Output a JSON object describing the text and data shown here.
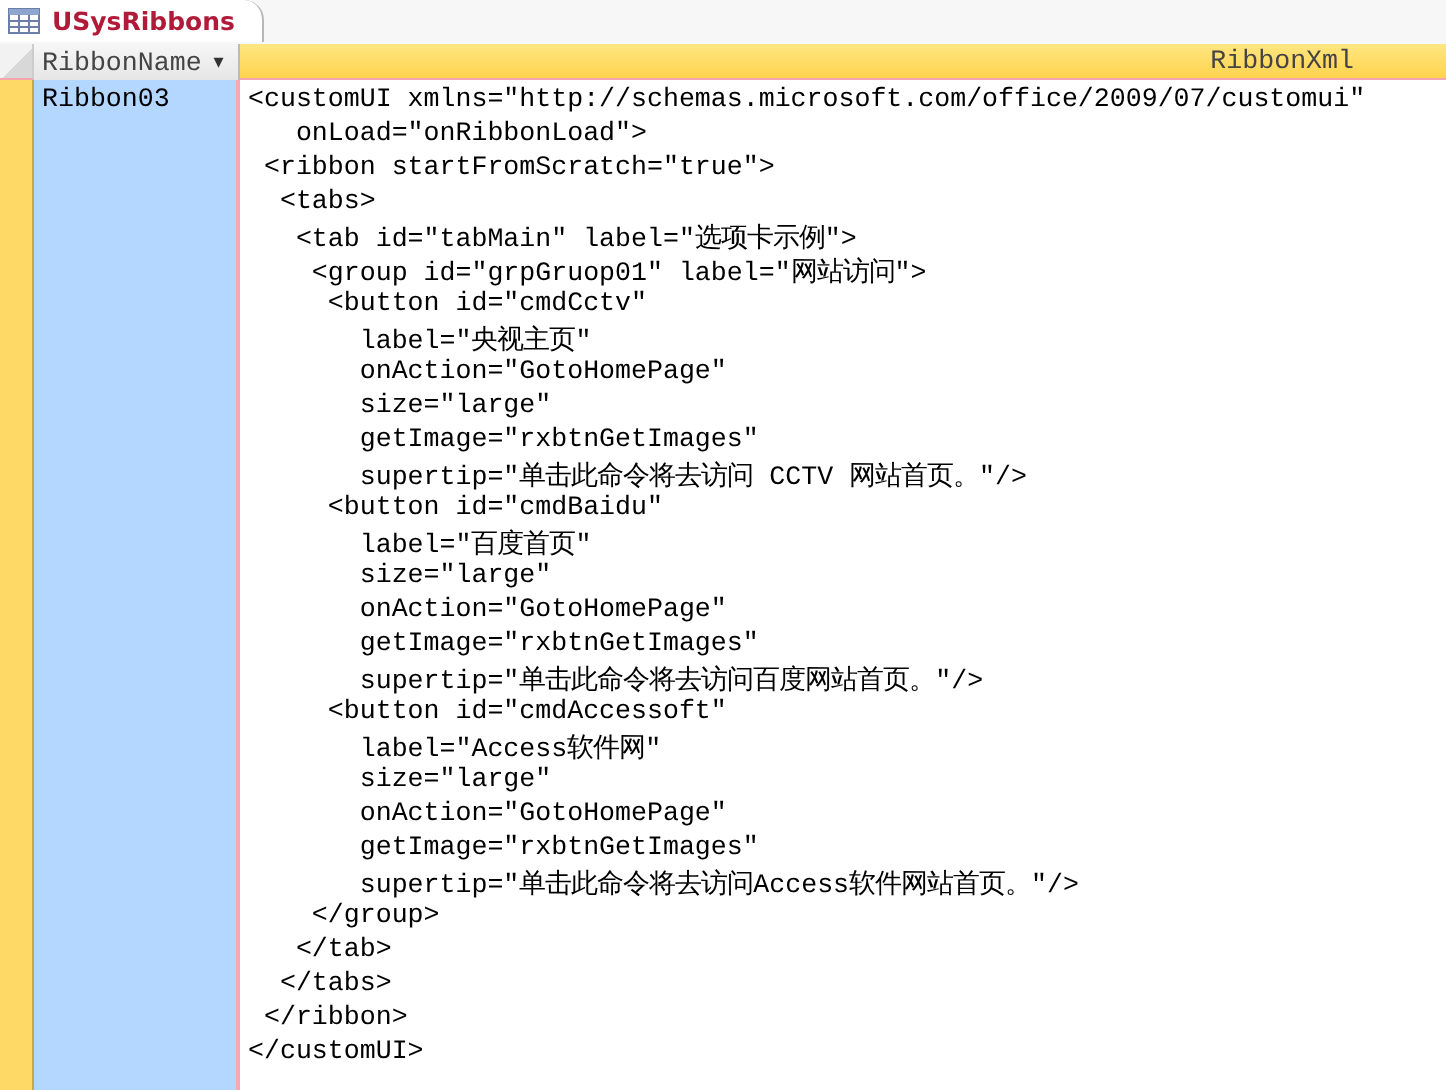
{
  "tab": {
    "title": "USysRibbons",
    "selected": true
  },
  "columns": [
    {
      "label": "RibbonName",
      "sort_menu": "▾"
    },
    {
      "label": "RibbonXml"
    }
  ],
  "rows": [
    {
      "ribbon_name": "Ribbon03",
      "selected": true,
      "ribbon_xml": [
        "<customUI xmlns=\"http://schemas.microsoft.com/office/2009/07/customui\"",
        "   onLoad=\"onRibbonLoad\">",
        " <ribbon startFromScratch=\"true\">",
        "  <tabs>",
        "   <tab id=\"tabMain\" label=\"选项卡示例\">",
        "    <group id=\"grpGruop01\" label=\"网站访问\">",
        "     <button id=\"cmdCctv\"",
        "       label=\"央视主页\"",
        "       onAction=\"GotoHomePage\"",
        "       size=\"large\"",
        "       getImage=\"rxbtnGetImages\"",
        "       supertip=\"单击此命令将去访问 CCTV 网站首页。\"/>",
        "     <button id=\"cmdBaidu\"",
        "       label=\"百度首页\"",
        "       size=\"large\"",
        "       onAction=\"GotoHomePage\"",
        "       getImage=\"rxbtnGetImages\"",
        "       supertip=\"单击此命令将去访问百度网站首页。\"/>",
        "     <button id=\"cmdAccessoft\"",
        "       label=\"Access软件网\"",
        "       size=\"large\"",
        "       onAction=\"GotoHomePage\"",
        "       getImage=\"rxbtnGetImages\"",
        "       supertip=\"单击此命令将去访问Access软件网站首页。\"/>",
        "    </group>",
        "   </tab>",
        "  </tabs>",
        " </ribbon>",
        "</customUI>"
      ]
    }
  ]
}
